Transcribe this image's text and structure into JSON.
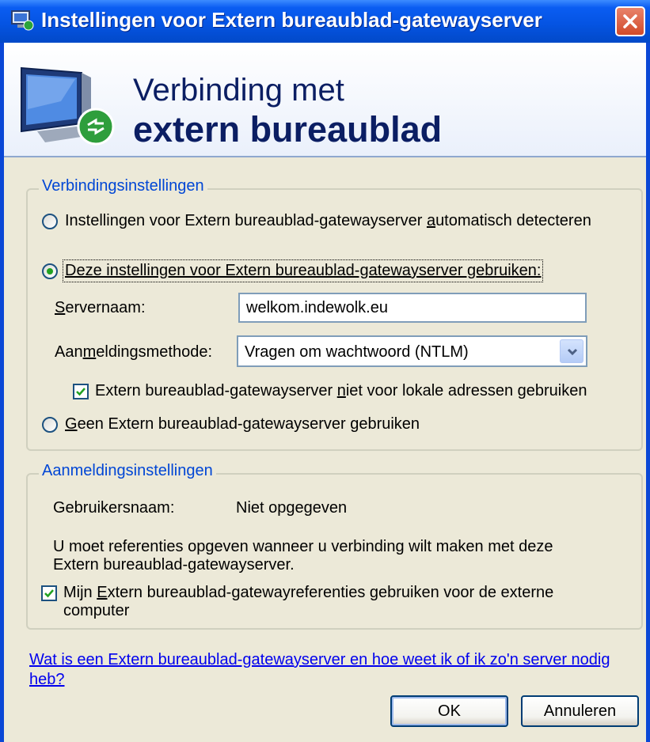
{
  "window": {
    "title": "Instellingen voor Extern bureaublad-gatewayserver",
    "close_icon": "close-icon",
    "title_icon": "remote-desktop-icon"
  },
  "banner": {
    "line1": "Verbinding met",
    "line2": "extern bureaublad",
    "icon": "monitor-icon"
  },
  "connection_group": {
    "legend": "Verbindingsinstellingen",
    "option_auto_pre": "Instellingen voor Extern bureaublad-gatewayserver ",
    "option_auto_u": "a",
    "option_auto_post": "utomatisch detecteren",
    "option_use": "Deze instellingen voor Extern bureaublad-gatewayserver gebruiken:",
    "option_use_selected": true,
    "server_label_u": "S",
    "server_label_post": "ervernaam:",
    "server_value": "welkom.indewolk.eu",
    "method_label_pre": "Aan",
    "method_label_u": "m",
    "method_label_post": "eldingsmethode:",
    "method_value": "Vragen om wachtwoord (NTLM)",
    "bypass_pre": "Extern bureaublad-gatewayserver ",
    "bypass_u": "n",
    "bypass_post": "iet voor lokale adressen gebruiken",
    "bypass_checked": true,
    "option_none_u": "G",
    "option_none_post": "een Extern bureaublad-gatewayserver gebruiken"
  },
  "login_group": {
    "legend": "Aanmeldingsinstellingen",
    "user_label": "Gebruikersnaam:",
    "user_value": "Niet opgegeven",
    "info_line1": "U moet referenties opgeven wanneer u verbinding wilt maken met deze",
    "info_line2": "Extern bureaublad-gatewayserver.",
    "reuse_pre": "Mijn ",
    "reuse_u": "E",
    "reuse_post": "xtern bureaublad-gatewayreferenties gebruiken voor de externe",
    "reuse_line2": "computer",
    "reuse_checked": true
  },
  "help_link": "Wat is een Extern bureaublad-gatewayserver en hoe weet ik of ik zo'n server nodig heb?",
  "buttons": {
    "ok": "OK",
    "cancel": "Annuleren"
  },
  "colors": {
    "titlebar": "#0554E3",
    "dialog_bg": "#ECE9D8",
    "legend_text": "#0046D5",
    "close_button": "#D14A2A",
    "radio_dot": "#21A121"
  }
}
